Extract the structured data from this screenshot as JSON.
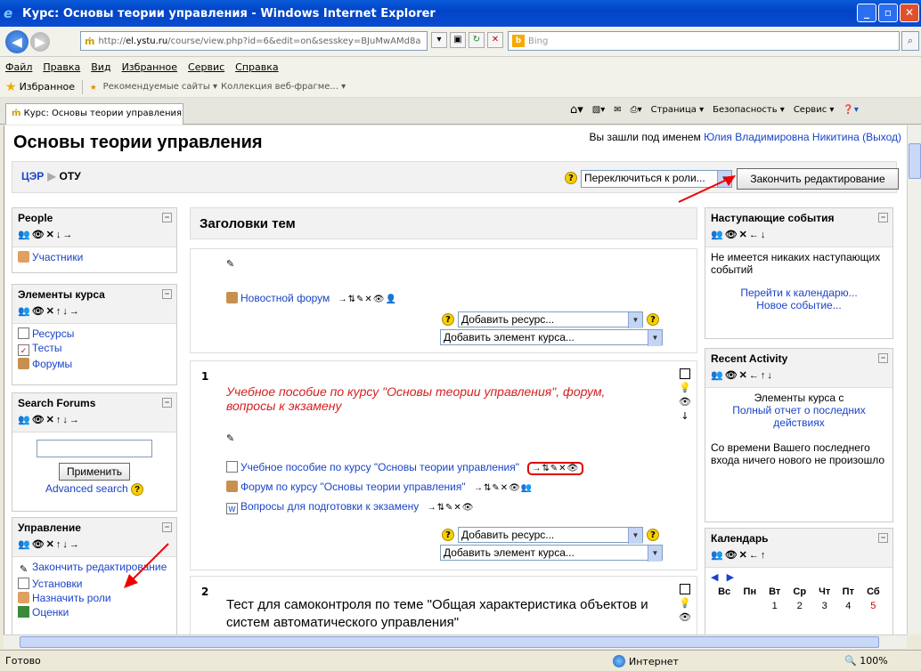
{
  "window": {
    "title": "Курс: Основы теории управления - Windows Internet Explorer"
  },
  "address": {
    "prefix": "http://",
    "host": "el.ystu.ru",
    "path": "/course/view.php?id=6&edit=on&sesskey=BJuMwAMd8a"
  },
  "search": {
    "placeholder": "Bing"
  },
  "menu": [
    "Файл",
    "Правка",
    "Вид",
    "Избранное",
    "Сервис",
    "Справка"
  ],
  "favorites": {
    "label": "Избранное",
    "items": [
      "Рекомендуемые сайты ▾",
      "Коллекция веб-фрагме... ▾"
    ]
  },
  "tab": {
    "title": "Курс: Основы теории управления"
  },
  "commands": [
    "Страница ▾",
    "Безопасность ▾",
    "Сервис ▾"
  ],
  "status": {
    "ready": "Готово",
    "zone": "Интернет",
    "zoom": "100%"
  },
  "page": {
    "heading": "Основы теории управления",
    "login_prefix": "Вы зашли под именем",
    "user": "Юлия Владимировна Никитина",
    "logout": "(Выход)",
    "crumb_root": "ЦЭР",
    "crumb_course": "ОТУ",
    "role_select": "Переключиться к роли...",
    "finish_edit": "Закончить редактирование"
  },
  "left": {
    "people": {
      "title": "People",
      "items": [
        "Участники"
      ]
    },
    "activities": {
      "title": "Элементы курса",
      "items": [
        "Ресурсы",
        "Тесты",
        "Форумы"
      ]
    },
    "search": {
      "title": "Search Forums",
      "button": "Применить",
      "advanced": "Advanced search"
    },
    "admin": {
      "title": "Управление",
      "items": [
        "Закончить редактирование",
        "Установки",
        "Назначить роли",
        "Оценки"
      ]
    }
  },
  "center": {
    "topics_title": "Заголовки тем",
    "section0": {
      "forum": "Новостной форум",
      "add_resource": "Добавить ресурс...",
      "add_activity": "Добавить элемент курса..."
    },
    "section1": {
      "num": "1",
      "summary": "Учебное пособие по курсу \"Основы теории управления\", форум, вопросы к экзамену",
      "items": [
        "Учебное пособие по курсу \"Основы теории управления\"",
        "Форум по курсу \"Основы теории управления\"",
        "Вопросы для подготовки к экзамену"
      ],
      "add_resource": "Добавить ресурс...",
      "add_activity": "Добавить элемент курса..."
    },
    "section2": {
      "num": "2",
      "summary": "Тест для самоконтроля по теме \"Общая характеристика объектов и систем автоматического управления\""
    }
  },
  "right": {
    "events": {
      "title": "Наступающие события",
      "empty": "Не имеется никаких наступающих событий",
      "calendar_link": "Перейти к календарю...",
      "new_event": "Новое событие..."
    },
    "recent": {
      "title": "Recent Activity",
      "elements": "Элементы курса с",
      "full_report": "Полный отчет о последних действиях",
      "nothing": "Со времени Вашего последнего входа ничего нового не произошло"
    },
    "calendar": {
      "title": "Календарь",
      "days": [
        "Вс",
        "Пн",
        "Вт",
        "Ср",
        "Чт",
        "Пт",
        "Сб"
      ],
      "first_row": [
        "",
        "",
        "1",
        "2",
        "3",
        "4",
        "5"
      ]
    }
  }
}
